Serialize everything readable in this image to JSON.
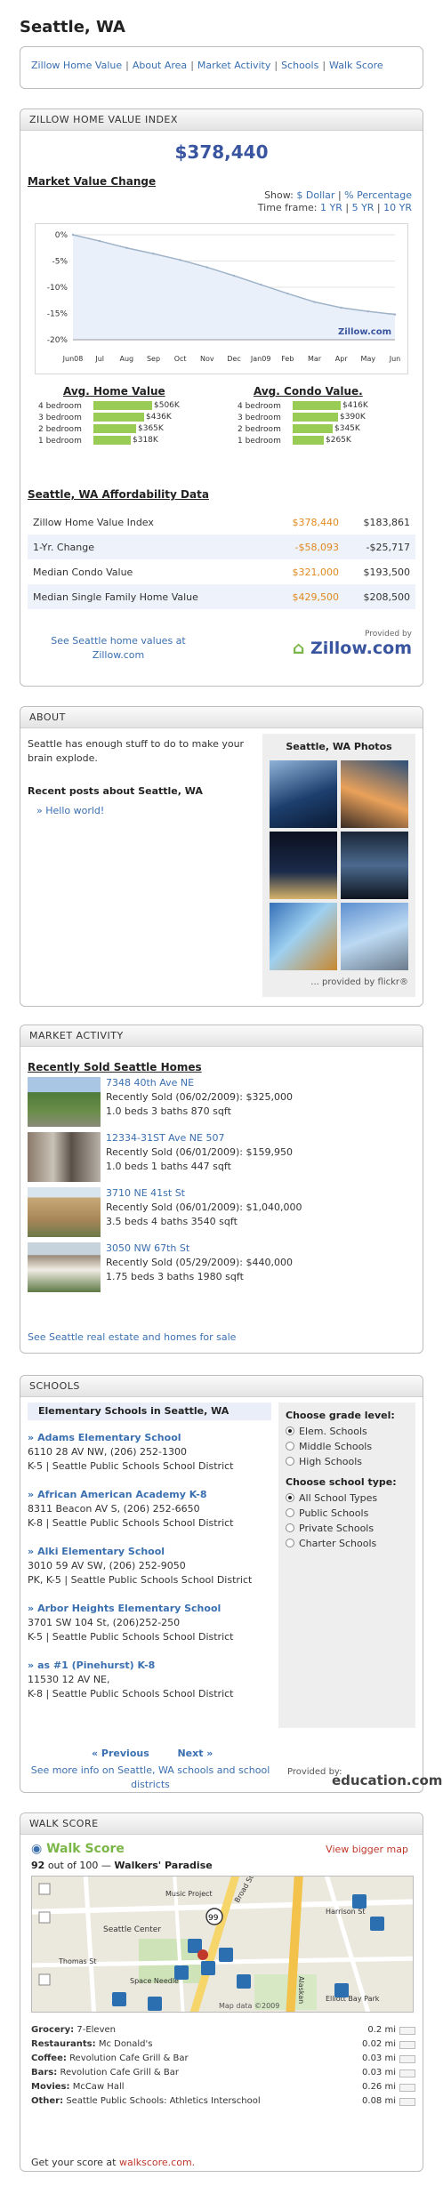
{
  "page_title": "Seattle, WA",
  "nav": [
    "Zillow Home Value",
    "About Area",
    "Market Activity",
    "Schools",
    "Walk Score"
  ],
  "zillow": {
    "header": "ZILLOW HOME VALUE INDEX",
    "value": "$378,440",
    "market_title": "Market Value Change",
    "show_label": "Show:",
    "show_opt1": "$ Dollar",
    "show_opt2": "% Percentage",
    "timeframe_label": "Time frame:",
    "tf1": "1 YR",
    "tf2": "5 YR",
    "tf3": "10 YR",
    "chart_brand": "Zillow.com",
    "avg_home_title": "Avg. Home Value",
    "avg_condo_title": "Avg. Condo Value.",
    "home_bars": [
      {
        "label": "4 bedroom",
        "value": "$506K",
        "num": 506
      },
      {
        "label": "3 bedroom",
        "value": "$436K",
        "num": 436
      },
      {
        "label": "2 bedroom",
        "value": "$365K",
        "num": 365
      },
      {
        "label": "1 bedroom",
        "value": "$318K",
        "num": 318
      }
    ],
    "condo_bars": [
      {
        "label": "4 bedroom",
        "value": "$416K",
        "num": 416
      },
      {
        "label": "3 bedroom",
        "value": "$390K",
        "num": 390
      },
      {
        "label": "2 bedroom",
        "value": "$345K",
        "num": 345
      },
      {
        "label": "1 bedroom",
        "value": "$265K",
        "num": 265
      }
    ],
    "affordability_title": "Seattle, WA Affordability Data",
    "affordability": [
      {
        "label": "Zillow Home Value Index",
        "v1": "$378,440",
        "v2": "$183,861"
      },
      {
        "label": "1-Yr. Change",
        "v1": "-$58,093",
        "v2": "-$25,717"
      },
      {
        "label": "Median Condo Value",
        "v1": "$321,000",
        "v2": "$193,500"
      },
      {
        "label": "Median Single Family Home Value",
        "v1": "$429,500",
        "v2": "$208,500"
      }
    ],
    "foot_link": "See Seattle home values at Zillow.com",
    "provided_by": "Provided by",
    "logo": "Zillow.com"
  },
  "chart_data": {
    "type": "area",
    "title": "",
    "x": [
      "Jun08",
      "Jul",
      "Aug",
      "Sep",
      "Oct",
      "Nov",
      "Dec",
      "Jan09",
      "Feb",
      "Mar",
      "Apr",
      "May",
      "Jun"
    ],
    "y_ticks": [
      "0%",
      "-5%",
      "-10%",
      "-15%",
      "-20%"
    ],
    "ylim": [
      -20,
      0
    ],
    "series": [
      {
        "values": [
          0,
          -1.2,
          -2.5,
          -3.6,
          -4.8,
          -6.2,
          -7.8,
          -9.5,
          -11.2,
          -12.8,
          -13.9,
          -14.6,
          -15.2
        ]
      }
    ],
    "fill_color": "#e9f0fa",
    "line_color": "#9fb2c8"
  },
  "about": {
    "header": "ABOUT",
    "text": "Seattle has enough stuff to do to make your brain explode.",
    "posts_title": "Recent posts about Seattle, WA",
    "post": "Hello world!",
    "photos_title": "Seattle, WA Photos",
    "photos_foot": "... provided by flickr®"
  },
  "market": {
    "header": "MARKET ACTIVITY",
    "title": "Recently Sold Seattle Homes",
    "listings": [
      {
        "addr": "7348 40th Ave NE",
        "sold": "Recently Sold (06/02/2009): $325,000",
        "details": "1.0 beds 3 baths 870 sqft"
      },
      {
        "addr": "12334-31ST Ave NE 507",
        "sold": "Recently Sold (06/01/2009): $159,950",
        "details": "1.0 beds 1 baths 447 sqft"
      },
      {
        "addr": "3710 NE 41st St",
        "sold": "Recently Sold (06/01/2009): $1,040,000",
        "details": "3.5 beds 4 baths 3540 sqft"
      },
      {
        "addr": "3050 NW 67th St",
        "sold": "Recently Sold (05/29/2009): $440,000",
        "details": "1.75 beds 3 baths 1980 sqft"
      }
    ],
    "foot": "See Seattle real estate and homes for sale"
  },
  "schools": {
    "header": "SCHOOLS",
    "list_title": "Elementary Schools in Seattle, WA",
    "items": [
      {
        "name": "Adams Elementary School",
        "addr": "6110 28 AV NW, (206) 252-1300",
        "info": "K-5 | Seattle Public Schools School District"
      },
      {
        "name": "African American Academy K-8",
        "addr": "8311 Beacon AV S, (206) 252-6650",
        "info": "K-8 | Seattle Public Schools School District"
      },
      {
        "name": "Alki Elementary School",
        "addr": "3010 59 AV SW, (206) 252-9050",
        "info": "PK, K-5 | Seattle Public Schools School District"
      },
      {
        "name": "Arbor Heights Elementary School",
        "addr": "3701 SW 104 St, (206)252-250",
        "info": "K-5 | Seattle Public Schools School District"
      },
      {
        "name": "as #1 (Pinehurst) K-8",
        "addr": "11530 12 AV NE,",
        "info": "K-8 | Seattle Public Schools School District"
      }
    ],
    "prev": "« Previous",
    "next": "Next »",
    "grade_title": "Choose grade level:",
    "grades": [
      "Elem. Schools",
      "Middle Schools",
      "High Schools"
    ],
    "type_title": "Choose school type:",
    "types": [
      "All School Types",
      "Public Schools",
      "Private Schools",
      "Charter Schools"
    ],
    "foot": "See more info on Seattle, WA schools and school districts",
    "provided_by": "Provided by:",
    "logo": "education.com"
  },
  "walk": {
    "header": "WALK SCORE",
    "logo": "Walk Score",
    "bigger": "View bigger map",
    "score": "92",
    "score_suffix": "out of 100 —",
    "score_label": "Walkers' Paradise",
    "map_labels": [
      "Seattle Center",
      "Space Needle",
      "Harrison St",
      "Thomas St",
      "Broad St",
      "Alaskan",
      "Elliott Bay Park",
      "Music Project",
      "Map data ©2009"
    ],
    "amenities": [
      {
        "k": "Grocery:",
        "v": "7-Eleven",
        "d": "0.2 mi"
      },
      {
        "k": "Restaurants:",
        "v": "Mc Donald's",
        "d": "0.02 mi"
      },
      {
        "k": "Coffee:",
        "v": "Revolution Cafe Grill & Bar",
        "d": "0.03 mi"
      },
      {
        "k": "Bars:",
        "v": "Revolution Cafe Grill & Bar",
        "d": "0.03 mi"
      },
      {
        "k": "Movies:",
        "v": "McCaw Hall",
        "d": "0.26 mi"
      },
      {
        "k": "Other:",
        "v": "Seattle Public Schools: Athletics Interschool",
        "d": "0.08 mi"
      }
    ],
    "foot_prefix": "Get your score at",
    "foot_link": "walkscore.com."
  }
}
